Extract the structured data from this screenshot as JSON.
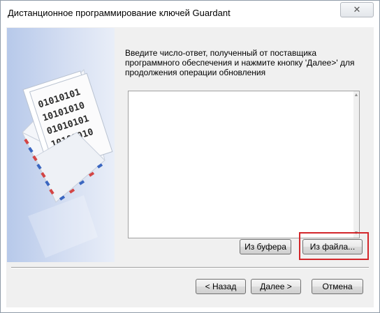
{
  "window": {
    "title": "Дистанционное программирование ключей Guardant",
    "close_glyph": "✕"
  },
  "instruction": "Введите число-ответ, полученный от поставщика программного обеспечения и нажмите кнопку 'Далее>' для продолжения операции обновления",
  "answer": {
    "value": "",
    "placeholder": ""
  },
  "buttons": {
    "from_buffer": "Из буфера",
    "from_file": "Из файла...",
    "back": "< Назад",
    "next": "Далее >",
    "cancel": "Отмена"
  },
  "banner": {
    "icon": "envelope-with-binary-papers",
    "binary_lines": [
      "01010101",
      "10101010",
      "01010101",
      "10101010"
    ],
    "colors": {
      "top": "#b7c9ea",
      "bottom": "#e9eef8"
    }
  },
  "highlight": {
    "color": "#d3262a"
  }
}
